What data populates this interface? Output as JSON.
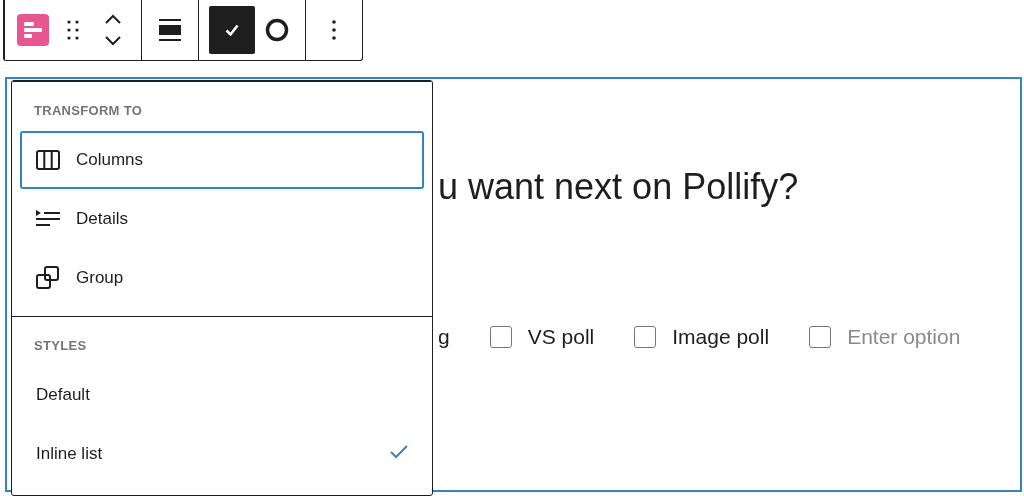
{
  "toolbar": {
    "groups": [
      {
        "tools": [
          {
            "kind": "block-type",
            "selected": false
          },
          {
            "kind": "drag",
            "selected": false
          },
          {
            "kind": "move",
            "selected": false
          }
        ]
      },
      {
        "tools": [
          {
            "kind": "align",
            "selected": false
          }
        ]
      },
      {
        "tools": [
          {
            "kind": "check",
            "selected": true
          },
          {
            "kind": "circle",
            "selected": false
          }
        ]
      },
      {
        "tools": [
          {
            "kind": "more",
            "selected": false
          }
        ]
      }
    ]
  },
  "menu": {
    "sections": [
      {
        "title": "TRANSFORM TO",
        "items": [
          {
            "label": "Columns",
            "kind": "columns",
            "focused": true
          },
          {
            "label": "Details",
            "kind": "details",
            "focused": false
          },
          {
            "label": "Group",
            "kind": "group",
            "focused": false
          }
        ]
      },
      {
        "title": "STYLES",
        "items": [
          {
            "label": "Default",
            "selected": false,
            "focused": false
          },
          {
            "label": "Inline list",
            "selected": true,
            "focused": false
          }
        ]
      }
    ]
  },
  "block": {
    "heading": "u want next on Pollify?",
    "options": [
      {
        "kind": "partial",
        "label": "g"
      },
      {
        "kind": "option",
        "label": "VS poll",
        "checked": false
      },
      {
        "kind": "option",
        "label": "Image poll",
        "checked": false
      },
      {
        "kind": "new",
        "placeholder": "Enter option",
        "checked": false
      }
    ]
  }
}
